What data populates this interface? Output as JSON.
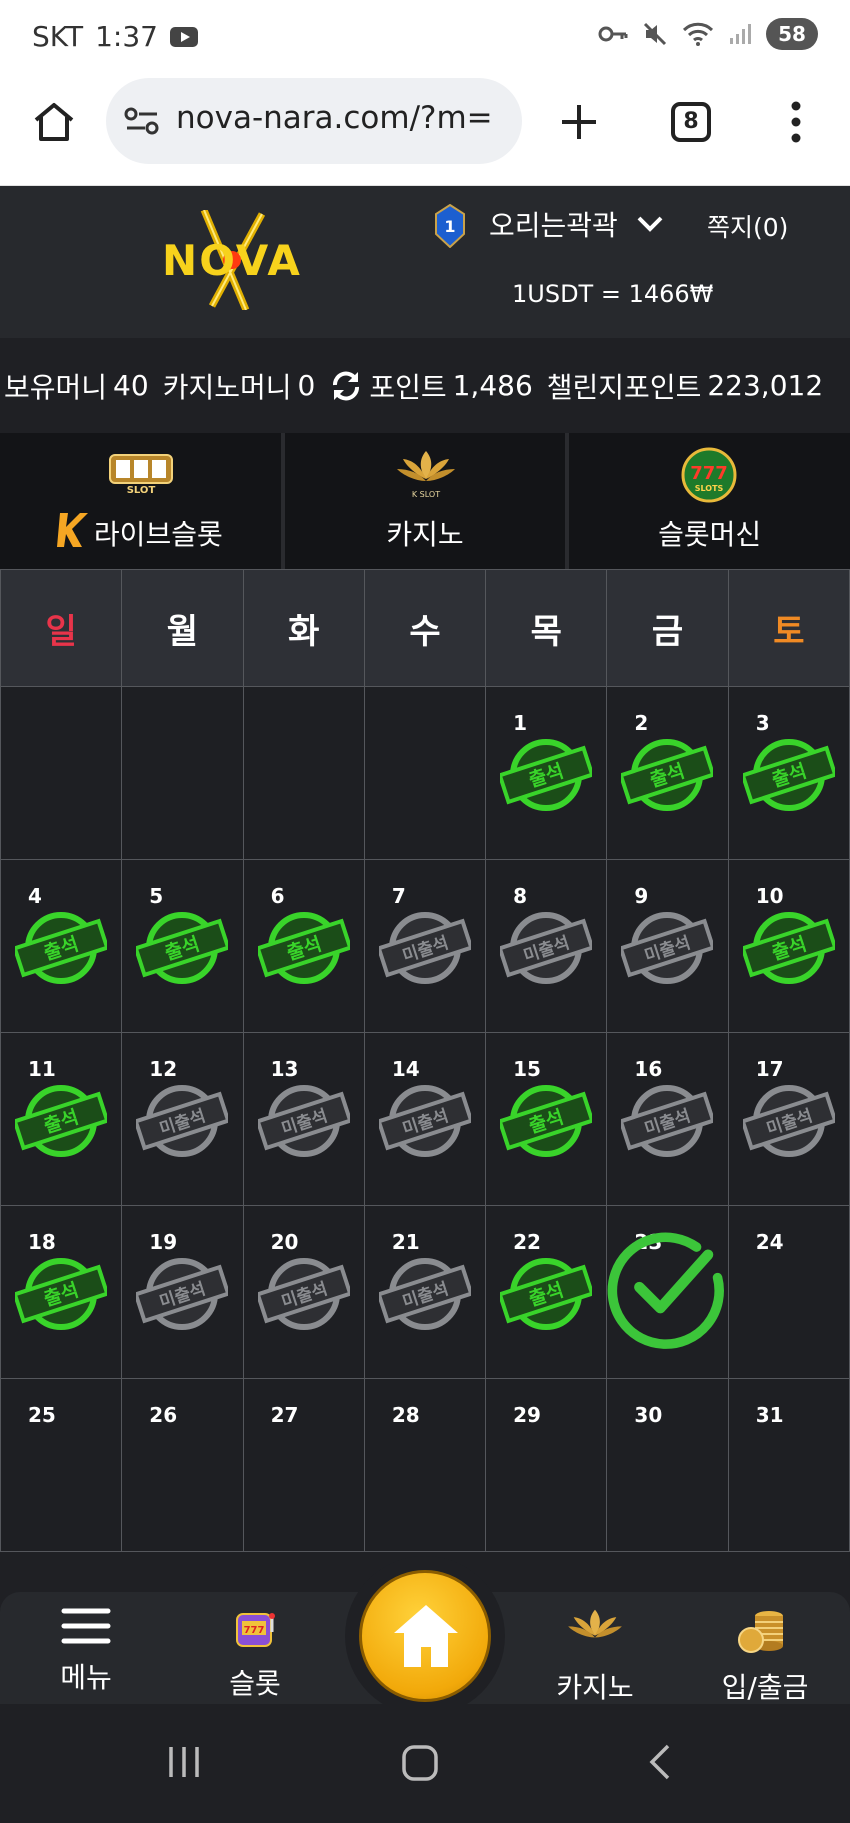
{
  "status_bar": {
    "carrier": "SKT",
    "time": "1:37",
    "battery": "58"
  },
  "browser": {
    "url": "nova-nara.com/?m=",
    "tab_count": "8"
  },
  "header": {
    "logo_text": "NOVA",
    "username": "오리는곽곽",
    "level": "1",
    "messages": "쪽지(0)",
    "exchange_rate": "1USDT = 1466₩"
  },
  "balance": {
    "holding_label": "보유머니",
    "holding_value": "40",
    "casino_label": "카지노머니",
    "casino_value": "0",
    "point_label": "포인트",
    "point_value": "1,486",
    "challenge_label": "챌린지포인트",
    "challenge_value": "223,012"
  },
  "categories": [
    {
      "label": "라이브슬롯",
      "icon": "live-slot-icon"
    },
    {
      "label": "카지노",
      "icon": "k-slot-lotus-icon"
    },
    {
      "label": "슬롯머신",
      "icon": "777-slots-icon"
    }
  ],
  "calendar": {
    "weekdays": [
      "일",
      "월",
      "화",
      "수",
      "목",
      "금",
      "토"
    ],
    "weekday_colors": [
      "#e8344a",
      "#ffffff",
      "#ffffff",
      "#ffffff",
      "#ffffff",
      "#ffffff",
      "#f08a24"
    ],
    "stamp_present": "출석",
    "stamp_absent": "미출석",
    "weeks": [
      [
        null,
        null,
        null,
        null,
        {
          "day": "1",
          "status": "present"
        },
        {
          "day": "2",
          "status": "present"
        },
        {
          "day": "3",
          "status": "present"
        }
      ],
      [
        {
          "day": "4",
          "status": "present"
        },
        {
          "day": "5",
          "status": "present"
        },
        {
          "day": "6",
          "status": "present"
        },
        {
          "day": "7",
          "status": "absent"
        },
        {
          "day": "8",
          "status": "absent"
        },
        {
          "day": "9",
          "status": "absent"
        },
        {
          "day": "10",
          "status": "present"
        }
      ],
      [
        {
          "day": "11",
          "status": "present"
        },
        {
          "day": "12",
          "status": "absent"
        },
        {
          "day": "13",
          "status": "absent"
        },
        {
          "day": "14",
          "status": "absent"
        },
        {
          "day": "15",
          "status": "present"
        },
        {
          "day": "16",
          "status": "absent"
        },
        {
          "day": "17",
          "status": "absent"
        }
      ],
      [
        {
          "day": "18",
          "status": "present"
        },
        {
          "day": "19",
          "status": "absent"
        },
        {
          "day": "20",
          "status": "absent"
        },
        {
          "day": "21",
          "status": "absent"
        },
        {
          "day": "22",
          "status": "present"
        },
        {
          "day": "23",
          "status": "today"
        },
        {
          "day": "24",
          "status": "none"
        }
      ],
      [
        {
          "day": "25",
          "status": "none"
        },
        {
          "day": "26",
          "status": "none"
        },
        {
          "day": "27",
          "status": "none"
        },
        {
          "day": "28",
          "status": "none"
        },
        {
          "day": "29",
          "status": "none"
        },
        {
          "day": "30",
          "status": "none"
        },
        {
          "day": "31",
          "status": "none"
        }
      ]
    ]
  },
  "bottom_nav": {
    "menu": "메뉴",
    "slot": "슬롯",
    "casino": "카지노",
    "deposit": "입/출금"
  },
  "colors": {
    "present_green": "#39d42a",
    "absent_gray": "#8a8c90",
    "check_green": "#3cc53a",
    "accent_gold": "#f2b01e"
  }
}
